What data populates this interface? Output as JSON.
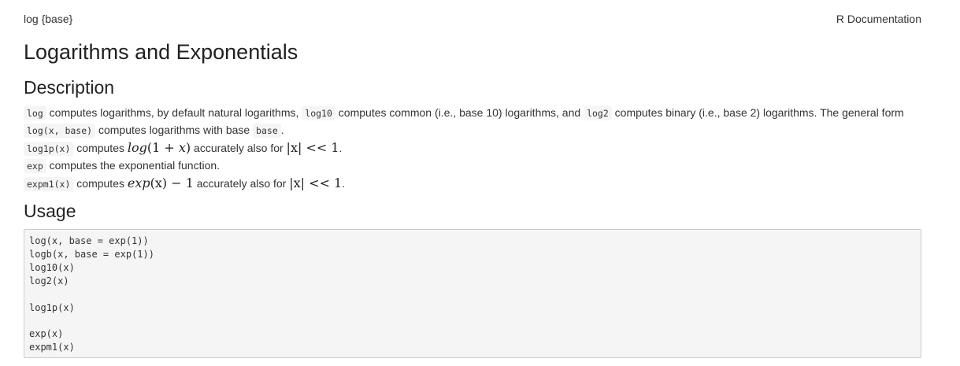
{
  "header": {
    "topic": "log {base}",
    "r_doc": "R Documentation"
  },
  "title": "Logarithms and Exponentials",
  "sections": {
    "description_heading": "Description",
    "usage_heading": "Usage"
  },
  "description": {
    "line1": {
      "code_log": "log",
      "text_a": " computes logarithms, by default natural logarithms, ",
      "code_log10": "log10",
      "text_b": " computes common (i.e., base 10) logarithms, and ",
      "code_log2": "log2",
      "text_c": " computes binary (i.e., base 2) logarithms. The general form"
    },
    "line2": {
      "code_logxbase": "log(x, base)",
      "text_a": " computes logarithms with base ",
      "code_base": "base",
      "text_b": "."
    },
    "line3": {
      "code": "log1p(x)",
      "text_a": " computes ",
      "math_fn": "log",
      "math_rest": "(1 + ",
      "math_x": "x",
      "math_close": ")",
      "text_b": " accurately also for ",
      "math_abs": "|x| << 1",
      "text_c": "."
    },
    "line4": {
      "code": "exp",
      "text": " computes the exponential function."
    },
    "line5": {
      "code": "expm1(x)",
      "text_a": " computes ",
      "math_fn": "exp",
      "math_rest": "(x) − 1",
      "text_b": " accurately also for ",
      "math_abs": "|x| << 1",
      "text_c": "."
    }
  },
  "usage_lines": [
    "log(x, base = exp(1))",
    "logb(x, base = exp(1))",
    "log10(x)",
    "log2(x)",
    "",
    "log1p(x)",
    "",
    "exp(x)",
    "expm1(x)"
  ]
}
